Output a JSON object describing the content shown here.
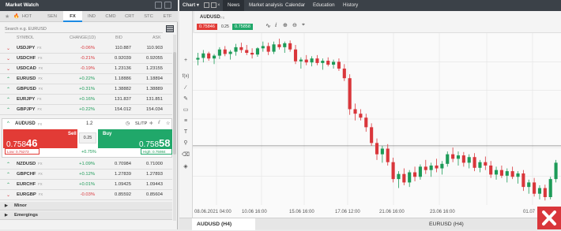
{
  "market_watch": {
    "title": "Market Watch",
    "tabs": [
      "HOT",
      "SEN",
      "FX",
      "IND",
      "CMD",
      "CRT",
      "STC",
      "ETF"
    ],
    "active_tab": "FX",
    "search_placeholder": "Search e.g. EURUSD",
    "columns": {
      "symbol": "SYMBOL",
      "change": "CHANGE(1D)",
      "bid": "BID",
      "ask": "ASK"
    },
    "rows_top": [
      {
        "symbol": "USDJPY",
        "tag": "FX",
        "change": "-0.06%",
        "bid": "110.887",
        "ask": "110.903",
        "dir": "down"
      },
      {
        "symbol": "USDCHF",
        "tag": "FX",
        "change": "-0.21%",
        "bid": "0.92039",
        "ask": "0.92055",
        "dir": "down"
      },
      {
        "symbol": "USDCAD",
        "tag": "FX",
        "change": "-0.19%",
        "bid": "1.23136",
        "ask": "1.23155",
        "dir": "down"
      },
      {
        "symbol": "EURUSD",
        "tag": "FX",
        "change": "+0.22%",
        "bid": "1.18886",
        "ask": "1.18894",
        "dir": "up"
      },
      {
        "symbol": "GBPUSD",
        "tag": "FX",
        "change": "+0.31%",
        "bid": "1.38882",
        "ask": "1.38889",
        "dir": "up"
      },
      {
        "symbol": "EURJPY",
        "tag": "FX",
        "change": "+0.16%",
        "bid": "131.837",
        "ask": "131.851",
        "dir": "up"
      },
      {
        "symbol": "GBPJPY",
        "tag": "FX",
        "change": "+0.22%",
        "bid": "154.012",
        "ask": "154.034",
        "dir": "up"
      }
    ],
    "expanded": {
      "symbol": "AUDUSD",
      "tag": "FX",
      "volume": "1.2",
      "sltp": "SL/TP",
      "sell_label": "Sell",
      "sell_price_main": "0.758",
      "sell_price_big": "46",
      "buy_label": "Buy",
      "buy_price_main": "0.758",
      "buy_price_big": "58",
      "spread": "0.25",
      "change": "+0.75%",
      "low": "Low: 0.75273",
      "high": "High: 0.75984"
    },
    "rows_bottom": [
      {
        "symbol": "NZDUSD",
        "tag": "FX",
        "change": "+1.09%",
        "bid": "0.70984",
        "ask": "0.71000",
        "dir": "up"
      },
      {
        "symbol": "GBPCHF",
        "tag": "FX",
        "change": "+0.12%",
        "bid": "1.27839",
        "ask": "1.27893",
        "dir": "up"
      },
      {
        "symbol": "EURCHF",
        "tag": "FX",
        "change": "+0.01%",
        "bid": "1.09425",
        "ask": "1.09443",
        "dir": "up"
      },
      {
        "symbol": "EURGBP",
        "tag": "FX",
        "change": "-0.03%",
        "bid": "0.85592",
        "ask": "0.85604",
        "dir": "down"
      }
    ],
    "groups": [
      "Minor",
      "Emergings"
    ]
  },
  "topbar": {
    "chart_label": "Chart",
    "nav": [
      "News",
      "Market analysis",
      "Calendar",
      "Education",
      "History"
    ]
  },
  "chart_toolbar": {
    "symbol": "AUDUSD",
    "tag": "FX",
    "sell_price": "0.75846",
    "spread": "0.25",
    "buy_price": "0.75858"
  },
  "chart_data": {
    "type": "candlestick",
    "xlabels": [
      "08.06.2021 04:00",
      "10.06 16:00",
      "15.06 16:00",
      "17.06 12:00",
      "21.06 16:00",
      "23.06 16:00",
      "01.07"
    ],
    "candles": [
      {
        "o": 0.7738,
        "h": 0.775,
        "l": 0.7728,
        "c": 0.7741
      },
      {
        "o": 0.7741,
        "h": 0.7755,
        "l": 0.7733,
        "c": 0.7749
      },
      {
        "o": 0.7749,
        "h": 0.7752,
        "l": 0.7736,
        "c": 0.774
      },
      {
        "o": 0.774,
        "h": 0.7748,
        "l": 0.773,
        "c": 0.7745
      },
      {
        "o": 0.7745,
        "h": 0.776,
        "l": 0.7739,
        "c": 0.7756
      },
      {
        "o": 0.7756,
        "h": 0.7762,
        "l": 0.7744,
        "c": 0.7748
      },
      {
        "o": 0.7748,
        "h": 0.7755,
        "l": 0.7738,
        "c": 0.7752
      },
      {
        "o": 0.7752,
        "h": 0.7766,
        "l": 0.7745,
        "c": 0.776
      },
      {
        "o": 0.776,
        "h": 0.7768,
        "l": 0.775,
        "c": 0.7755
      },
      {
        "o": 0.7755,
        "h": 0.7764,
        "l": 0.7746,
        "c": 0.775
      },
      {
        "o": 0.775,
        "h": 0.7758,
        "l": 0.774,
        "c": 0.7747
      },
      {
        "o": 0.7747,
        "h": 0.776,
        "l": 0.7743,
        "c": 0.7758
      },
      {
        "o": 0.7758,
        "h": 0.777,
        "l": 0.7752,
        "c": 0.7762
      },
      {
        "o": 0.7762,
        "h": 0.7768,
        "l": 0.7746,
        "c": 0.7752
      },
      {
        "o": 0.7752,
        "h": 0.777,
        "l": 0.7748,
        "c": 0.7765
      },
      {
        "o": 0.7765,
        "h": 0.7775,
        "l": 0.7756,
        "c": 0.776
      },
      {
        "o": 0.776,
        "h": 0.777,
        "l": 0.775,
        "c": 0.7767
      },
      {
        "o": 0.7767,
        "h": 0.7772,
        "l": 0.7752,
        "c": 0.7756
      },
      {
        "o": 0.7756,
        "h": 0.7764,
        "l": 0.773,
        "c": 0.7735
      },
      {
        "o": 0.7735,
        "h": 0.7742,
        "l": 0.7722,
        "c": 0.7738
      },
      {
        "o": 0.7738,
        "h": 0.7746,
        "l": 0.7728,
        "c": 0.7733
      },
      {
        "o": 0.7733,
        "h": 0.7744,
        "l": 0.7726,
        "c": 0.774
      },
      {
        "o": 0.774,
        "h": 0.7746,
        "l": 0.7728,
        "c": 0.7732
      },
      {
        "o": 0.7732,
        "h": 0.774,
        "l": 0.772,
        "c": 0.7736
      },
      {
        "o": 0.7736,
        "h": 0.7742,
        "l": 0.7726,
        "c": 0.7729
      },
      {
        "o": 0.7729,
        "h": 0.7738,
        "l": 0.7722,
        "c": 0.7734
      },
      {
        "o": 0.7734,
        "h": 0.774,
        "l": 0.7718,
        "c": 0.7722
      },
      {
        "o": 0.7722,
        "h": 0.773,
        "l": 0.77,
        "c": 0.7705
      },
      {
        "o": 0.7705,
        "h": 0.7712,
        "l": 0.764,
        "c": 0.765
      },
      {
        "o": 0.765,
        "h": 0.766,
        "l": 0.763,
        "c": 0.7642
      },
      {
        "o": 0.7642,
        "h": 0.765,
        "l": 0.763,
        "c": 0.7635
      },
      {
        "o": 0.7635,
        "h": 0.7642,
        "l": 0.761,
        "c": 0.7618
      },
      {
        "o": 0.7618,
        "h": 0.7625,
        "l": 0.7585,
        "c": 0.759
      },
      {
        "o": 0.759,
        "h": 0.7598,
        "l": 0.756,
        "c": 0.757
      },
      {
        "o": 0.757,
        "h": 0.7585,
        "l": 0.7555,
        "c": 0.758
      },
      {
        "o": 0.758,
        "h": 0.7588,
        "l": 0.755,
        "c": 0.7556
      },
      {
        "o": 0.7556,
        "h": 0.7564,
        "l": 0.752,
        "c": 0.7526
      },
      {
        "o": 0.7526,
        "h": 0.754,
        "l": 0.751,
        "c": 0.7535
      },
      {
        "o": 0.7535,
        "h": 0.7545,
        "l": 0.7515,
        "c": 0.752
      },
      {
        "o": 0.752,
        "h": 0.7542,
        "l": 0.7512,
        "c": 0.7538
      },
      {
        "o": 0.7538,
        "h": 0.7548,
        "l": 0.7522,
        "c": 0.753
      },
      {
        "o": 0.753,
        "h": 0.7552,
        "l": 0.7525,
        "c": 0.7548
      },
      {
        "o": 0.7548,
        "h": 0.756,
        "l": 0.7535,
        "c": 0.7542
      },
      {
        "o": 0.7542,
        "h": 0.7555,
        "l": 0.753,
        "c": 0.755
      },
      {
        "o": 0.755,
        "h": 0.7562,
        "l": 0.7538,
        "c": 0.7545
      },
      {
        "o": 0.7545,
        "h": 0.7558,
        "l": 0.7534,
        "c": 0.7553
      },
      {
        "o": 0.7553,
        "h": 0.7575,
        "l": 0.7548,
        "c": 0.757
      },
      {
        "o": 0.757,
        "h": 0.7582,
        "l": 0.7556,
        "c": 0.7562
      },
      {
        "o": 0.7562,
        "h": 0.7575,
        "l": 0.755,
        "c": 0.7568
      },
      {
        "o": 0.7568,
        "h": 0.7574,
        "l": 0.7548,
        "c": 0.7555
      },
      {
        "o": 0.7555,
        "h": 0.757,
        "l": 0.7545,
        "c": 0.7565
      },
      {
        "o": 0.7565,
        "h": 0.7572,
        "l": 0.754,
        "c": 0.7546
      },
      {
        "o": 0.7546,
        "h": 0.756,
        "l": 0.7538,
        "c": 0.7556
      },
      {
        "o": 0.7556,
        "h": 0.7566,
        "l": 0.7542,
        "c": 0.755
      },
      {
        "o": 0.755,
        "h": 0.7558,
        "l": 0.7528,
        "c": 0.7534
      },
      {
        "o": 0.7534,
        "h": 0.7548,
        "l": 0.7525,
        "c": 0.7542
      },
      {
        "o": 0.7542,
        "h": 0.755,
        "l": 0.7528,
        "c": 0.7532
      },
      {
        "o": 0.7532,
        "h": 0.7545,
        "l": 0.752,
        "c": 0.754
      },
      {
        "o": 0.754,
        "h": 0.7548,
        "l": 0.7526,
        "c": 0.753
      },
      {
        "o": 0.753,
        "h": 0.754,
        "l": 0.7518,
        "c": 0.7536
      },
      {
        "o": 0.7536,
        "h": 0.7542,
        "l": 0.7505,
        "c": 0.7512
      },
      {
        "o": 0.7512,
        "h": 0.7525,
        "l": 0.75,
        "c": 0.752
      },
      {
        "o": 0.752,
        "h": 0.7528,
        "l": 0.7495,
        "c": 0.75
      },
      {
        "o": 0.75,
        "h": 0.7515,
        "l": 0.749,
        "c": 0.751
      },
      {
        "o": 0.751,
        "h": 0.7516,
        "l": 0.7488,
        "c": 0.7494
      },
      {
        "o": 0.7494,
        "h": 0.753,
        "l": 0.749,
        "c": 0.7526
      },
      {
        "o": 0.7526,
        "h": 0.756,
        "l": 0.752,
        "c": 0.7555
      }
    ],
    "price_line": 0.7585,
    "ylim": [
      0.748,
      0.7785
    ]
  },
  "bottom_tabs": [
    "AUDUSD (H4)",
    "EURUSD (H4)"
  ],
  "colors": {
    "up": "#1d9b58",
    "down": "#d9363b",
    "header": "#3b4148",
    "accent": "#1d8ae3"
  }
}
